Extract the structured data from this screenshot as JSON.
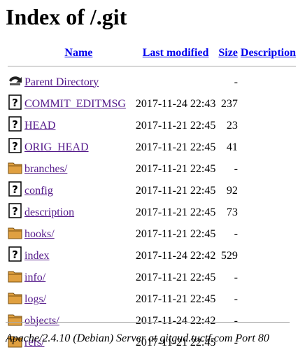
{
  "page": {
    "title": "Index of /.git"
  },
  "table": {
    "headers": {
      "name": "Name",
      "last_modified": "Last modified",
      "size": "Size",
      "description": "Description"
    },
    "parent": {
      "label": "Parent Directory",
      "size": "-",
      "icon": "back-arrow-icon"
    },
    "rows": [
      {
        "name": "COMMIT_EDITMSG",
        "modified": "2017-11-24 22:43",
        "size": "237",
        "icon": "unknown-file-icon"
      },
      {
        "name": "HEAD",
        "modified": "2017-11-21 22:45",
        "size": "23",
        "icon": "unknown-file-icon"
      },
      {
        "name": "ORIG_HEAD",
        "modified": "2017-11-21 22:45",
        "size": "41",
        "icon": "unknown-file-icon"
      },
      {
        "name": "branches/",
        "modified": "2017-11-21 22:45",
        "size": "-",
        "icon": "folder-icon"
      },
      {
        "name": "config",
        "modified": "2017-11-21 22:45",
        "size": "92",
        "icon": "unknown-file-icon"
      },
      {
        "name": "description",
        "modified": "2017-11-21 22:45",
        "size": "73",
        "icon": "unknown-file-icon"
      },
      {
        "name": "hooks/",
        "modified": "2017-11-21 22:45",
        "size": "-",
        "icon": "folder-icon"
      },
      {
        "name": "index",
        "modified": "2017-11-24 22:42",
        "size": "529",
        "icon": "unknown-file-icon"
      },
      {
        "name": "info/",
        "modified": "2017-11-21 22:45",
        "size": "-",
        "icon": "folder-icon"
      },
      {
        "name": "logs/",
        "modified": "2017-11-21 22:45",
        "size": "-",
        "icon": "folder-icon"
      },
      {
        "name": "objects/",
        "modified": "2017-11-24 22:42",
        "size": "-",
        "icon": "folder-icon"
      },
      {
        "name": "refs/",
        "modified": "2017-11-21 22:45",
        "size": "-",
        "icon": "folder-icon"
      }
    ]
  },
  "footer": {
    "address": "Apache/2.4.10 (Debian) Server at gitgud.tuctf.com Port 80"
  },
  "colors": {
    "link": "#551a8b",
    "header_link": "#0000ee",
    "rule": "#aaaaaa"
  }
}
